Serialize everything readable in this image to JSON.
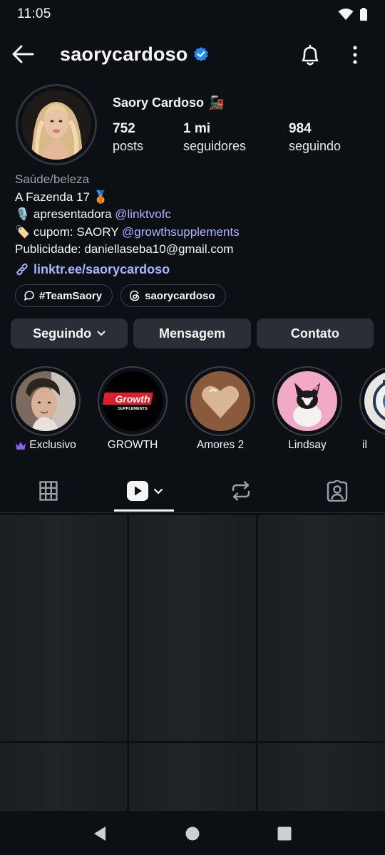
{
  "status_bar": {
    "time": "11:05"
  },
  "header": {
    "username": "saorycardoso"
  },
  "profile": {
    "display_name": "Saory Cardoso",
    "name_emoji": "🚂",
    "stats": [
      {
        "value": "752",
        "label": "posts"
      },
      {
        "value": "1 mi",
        "label": "seguidores"
      },
      {
        "value": "984",
        "label": "seguindo"
      }
    ]
  },
  "bio": {
    "category": "Saúde/beleza",
    "line1": "A Fazenda 17 🥉",
    "line2_prefix": "🎙️ apresentadora ",
    "line2_mention": "@linktvofc",
    "line3_prefix": "🏷️ cupom: SAORY ",
    "line3_mention": "@growthsupplements",
    "line4": "Publicidade: daniellaseba10@gmail.com",
    "link": "linktr.ee/saorycardoso"
  },
  "chips": {
    "hashtag": "#TeamSaory",
    "threads": "saorycardoso"
  },
  "actions": {
    "following": "Seguindo",
    "message": "Mensagem",
    "contact": "Contato"
  },
  "highlights": [
    {
      "label": "Exclusivo"
    },
    {
      "label": "GROWTH",
      "logo_top": "Growth",
      "logo_bottom": "SUPPLEMENTS"
    },
    {
      "label": "Amores 2"
    },
    {
      "label": "Lindsay"
    },
    {
      "label": "il"
    }
  ],
  "colors": {
    "background": "#0c0f14",
    "button": "#2a2e35",
    "link": "#a9b5ff",
    "verified": "#1d8cf8",
    "exclusive_crown": "#8b5cf6",
    "growth_red": "#e21d2a"
  }
}
